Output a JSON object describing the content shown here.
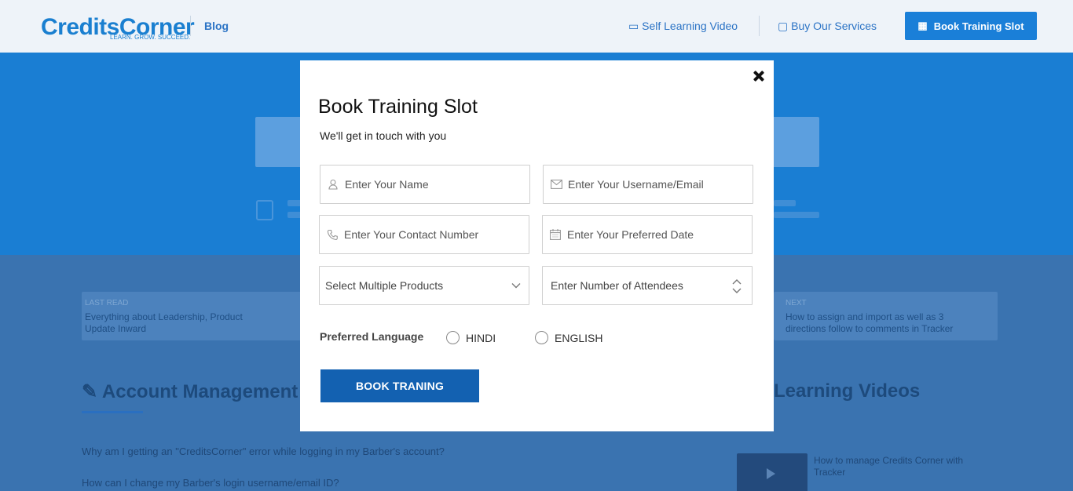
{
  "background": {
    "logo": "Cre​ditsCorner",
    "logo_sub": "LEARN. GROW. SUCCEED.",
    "nav_blog": "Blog",
    "nav_self_learning": "Self Learning Video",
    "nav_services": "Buy Our Services",
    "nav_book_button": "Book Training Slot",
    "card_left_caption": "LAST READ",
    "card_left_text": "Everything about Leadership, Product Update Inward",
    "card_right_caption": "NEXT",
    "card_right_text": "How to assign and import as well as 3 directions follow to comments in Tracker",
    "section_heading_left": "Account Management",
    "section_heading_right": "Learning Videos",
    "faq_1": "Why am I getting an \"CreditsCorner\" error while logging in my Barber's account?",
    "faq_2": "How can I change my Barber's login username/email ID?",
    "side_video_title": "How to manage Credits Corner with Tracker"
  },
  "modal": {
    "title": "Book Training Slot",
    "subtitle": "We'll get in touch with you",
    "name_placeholder": "Enter Your Name",
    "email_placeholder": "Enter Your Username/Email",
    "contact_placeholder": "Enter Your Contact Number",
    "date_placeholder": "Enter Your Preferred Date",
    "products_value": "Select Multiple Products",
    "attendees_placeholder": "Enter Number of Attendees",
    "language_label": "Preferred Language",
    "language_options": [
      "HINDI",
      "ENGLISH"
    ],
    "submit_label": "BOOK TRANING"
  },
  "colors": {
    "submit_bg": "#1361b1",
    "overlay": "#5c8cc0",
    "hero": "#1a7ed3"
  }
}
